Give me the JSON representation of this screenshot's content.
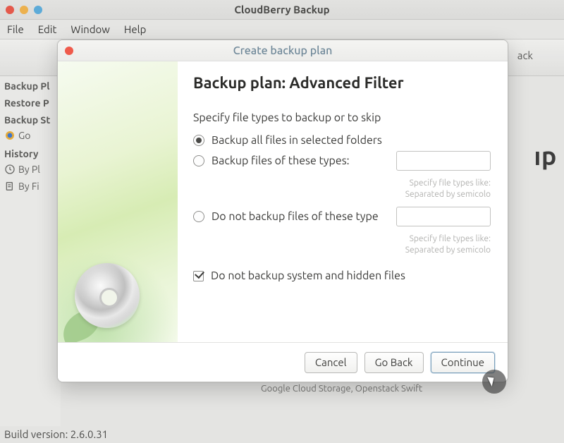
{
  "app": {
    "title": "CloudBerry Backup",
    "menubar": [
      "File",
      "Edit",
      "Window",
      "Help"
    ],
    "toolbar_back": "ack",
    "build_label": "Build version: 2.6.0.31",
    "providers_footer": "Google Cloud Storage, Openstack Swift",
    "right_word_fragment": "ıp"
  },
  "sidebar": {
    "sections": {
      "backup_plans": "Backup Pl",
      "restore_plans": "Restore P",
      "backup_storage": "Backup St",
      "history": "History"
    },
    "items": {
      "google": "Go",
      "by_plan": "By Pl",
      "by_file": "By Fi"
    }
  },
  "dialog": {
    "window_title": "Create backup plan",
    "heading": "Backup plan: Advanced Filter",
    "subheading": "Specify file types to backup or to skip",
    "options": {
      "all": "Backup all files in selected folders",
      "include": "Backup files of these types:",
      "exclude": "Do not backup files of these type"
    },
    "include_value": "",
    "exclude_value": "",
    "hint_line1": "Specify file types like:",
    "hint_line2": "Separated by semicolo",
    "checkbox_label": "Do not backup system and hidden files",
    "selected_option": "all",
    "checkbox_checked": true,
    "buttons": {
      "cancel": "Cancel",
      "back": "Go Back",
      "continue": "Continue"
    }
  }
}
